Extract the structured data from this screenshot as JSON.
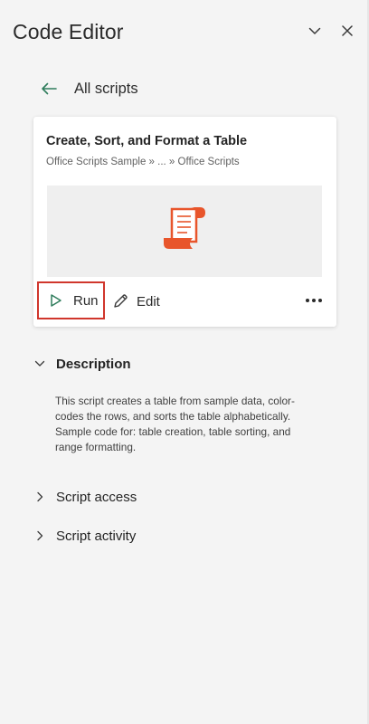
{
  "header": {
    "title": "Code Editor"
  },
  "nav": {
    "back_label": "All scripts"
  },
  "script_card": {
    "title": "Create, Sort, and Format a Table",
    "path": "Office Scripts Sample » ... » Office Scripts",
    "run_label": "Run",
    "edit_label": "Edit"
  },
  "description": {
    "heading": "Description",
    "text": "This script creates a table from sample data, color-codes the rows, and sorts the table alphabetically. Sample code for: table creation, table sorting, and range formatting."
  },
  "sections": {
    "script_access": "Script access",
    "script_activity": "Script activity"
  },
  "colors": {
    "accent_green": "#2f7d5c",
    "highlight_red": "#d0362c",
    "script_icon_orange": "#e8552b"
  },
  "icons": {
    "collapse": "chevron-down-icon",
    "close": "close-icon",
    "back": "arrow-left-icon",
    "script": "script-scroll-icon",
    "run": "play-icon",
    "edit": "pencil-icon",
    "more": "more-options-icon",
    "expand": "chevron-right-icon",
    "collapse_section": "chevron-down-icon"
  }
}
